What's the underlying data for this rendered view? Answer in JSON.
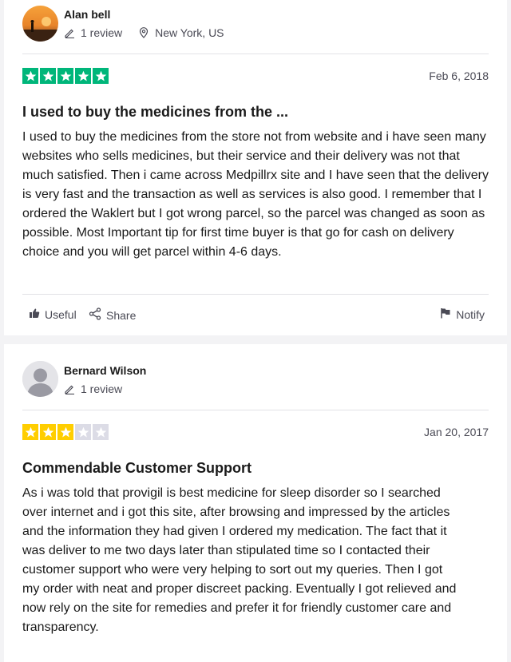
{
  "reviews": [
    {
      "author": "Alan bell",
      "review_count": "1 review",
      "location": "New York, US",
      "rating": 5,
      "date": "Feb 6, 2018",
      "title": "I used to buy the medicines from the ...",
      "body": "I used to buy the medicines from the store not from website and i have seen many websites who sells medicines, but their service and their delivery was not that much satisfied. Then i came across Medpillrx site and I have seen that the delivery is very fast and the transaction as well as services is also good. I remember that I ordered the Waklert but I got wrong parcel, so the parcel was changed as soon as possible. Most Important tip for first time buyer is that go for cash on delivery choice and you will get parcel within 4-6 days.",
      "actions": {
        "useful": "Useful",
        "share": "Share",
        "notify": "Notify"
      }
    },
    {
      "author": "Bernard Wilson",
      "review_count": "1 review",
      "rating": 3,
      "date": "Jan 20, 2017",
      "title": "Commendable Customer Support",
      "body": "As i was told that provigil is best medicine for sleep disorder so I searched over internet and i got this site, after browsing and impressed by the articles and the information they had given I ordered my medication. The fact that it was deliver to me two days later than stipulated time so I contacted their customer support who were very helping to sort out my queries. Then I got my order with neat and proper discreet packing. Eventually I got relieved and now rely on the site for remedies and prefer it for friendly customer care and transparency."
    }
  ],
  "colors": {
    "five_star": "#00b67a",
    "three_star": "#ffce00",
    "empty_star": "#dcdce6"
  }
}
